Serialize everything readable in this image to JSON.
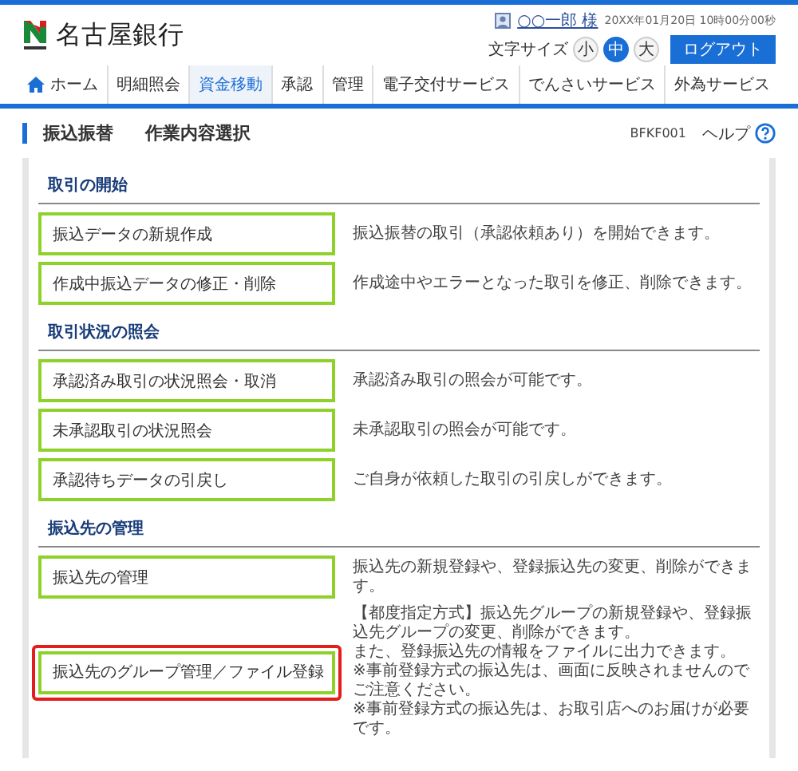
{
  "header": {
    "bank_name": "名古屋銀行",
    "user_name": "○○一郎 様",
    "datetime": "20XX年01月20日 10時00分00秒",
    "font_size_label": "文字サイズ",
    "font_sizes": [
      {
        "label": "小",
        "selected": false
      },
      {
        "label": "中",
        "selected": true
      },
      {
        "label": "大",
        "selected": false
      }
    ],
    "logout": "ログアウト"
  },
  "nav": [
    {
      "label": "ホーム",
      "kind": "home",
      "selected": false
    },
    {
      "label": "明細照会",
      "kind": "text",
      "selected": false
    },
    {
      "label": "資金移動",
      "kind": "text",
      "selected": true
    },
    {
      "label": "承認",
      "kind": "text",
      "selected": false
    },
    {
      "label": "管理",
      "kind": "text",
      "selected": false
    },
    {
      "label": "電子交付サービス",
      "kind": "text",
      "selected": false
    },
    {
      "label": "でんさいサービス",
      "kind": "text",
      "selected": false
    },
    {
      "label": "外為サービス",
      "kind": "text",
      "selected": false
    }
  ],
  "page": {
    "category": "振込振替",
    "title": "作業内容選択",
    "screen_id": "BFKF001",
    "help": "ヘルプ"
  },
  "sections": [
    {
      "heading": "取引の開始",
      "items": [
        {
          "button": "振込データの新規作成",
          "highlighted": false,
          "description": [
            "振込振替の取引（承認依頼あり）を開始できます。"
          ]
        },
        {
          "button": "作成中振込データの修正・削除",
          "highlighted": false,
          "description": [
            "作成途中やエラーとなった取引を修正、削除できます。"
          ]
        }
      ]
    },
    {
      "heading": "取引状況の照会",
      "items": [
        {
          "button": "承認済み取引の状況照会・取消",
          "highlighted": false,
          "description": [
            "承認済み取引の照会が可能です。"
          ]
        },
        {
          "button": "未承認取引の状況照会",
          "highlighted": false,
          "description": [
            "未承認取引の照会が可能です。"
          ]
        },
        {
          "button": "承認待ちデータの引戻し",
          "highlighted": false,
          "description": [
            "ご自身が依頼した取引の引戻しができます。"
          ]
        }
      ]
    },
    {
      "heading": "振込先の管理",
      "items": [
        {
          "button": "振込先の管理",
          "highlighted": false,
          "description": [
            "振込先の新規登録や、登録振込先の変更、削除ができます。"
          ]
        },
        {
          "button": "振込先のグループ管理／ファイル登録",
          "highlighted": true,
          "description": [
            "【都度指定方式】振込先グループの新規登録や、登録振込先グループの変更、削除ができます。",
            "また、登録振込先の情報をファイルに出力できます。",
            "※事前登録方式の振込先は、画面に反映されませんのでご注意ください。",
            "※事前登録方式の振込先は、お取引店へのお届けが必要です。"
          ]
        }
      ]
    }
  ]
}
